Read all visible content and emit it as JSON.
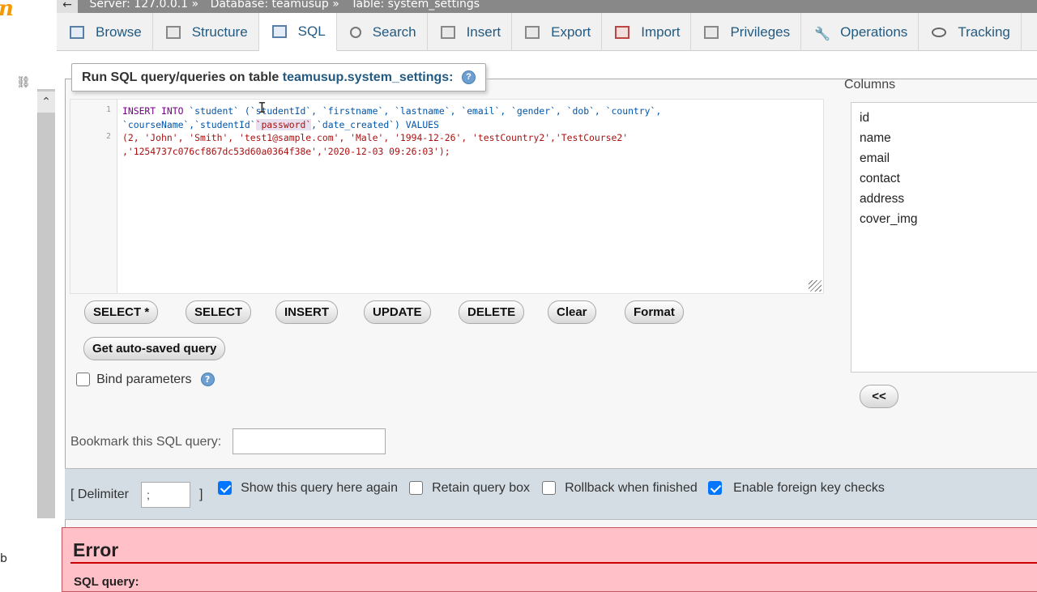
{
  "breadcrumb": {
    "back": "←",
    "server": "Server: 127.0.0.1",
    "sep": "»",
    "database": "Database: teamusup",
    "table": "Table: system_settings"
  },
  "tabs": [
    {
      "label": "Browse",
      "icon": "browse-icon"
    },
    {
      "label": "Structure",
      "icon": "structure-icon"
    },
    {
      "label": "SQL",
      "icon": "sql-icon",
      "active": true
    },
    {
      "label": "Search",
      "icon": "search-icon"
    },
    {
      "label": "Insert",
      "icon": "insert-icon"
    },
    {
      "label": "Export",
      "icon": "export-icon"
    },
    {
      "label": "Import",
      "icon": "import-icon"
    },
    {
      "label": "Privileges",
      "icon": "privileges-icon"
    },
    {
      "label": "Operations",
      "icon": "wrench-icon"
    },
    {
      "label": "Tracking",
      "icon": "eye-icon"
    }
  ],
  "query_panel": {
    "legend_prefix": "Run SQL query/queries on table ",
    "legend_table": "teamusup.system_settings:",
    "help": "?"
  },
  "editor": {
    "line_numbers": [
      "1",
      "2"
    ],
    "sql": {
      "l1_a": "INSERT INTO",
      "l1_b": "`student`",
      "l1_c": " (`studentId`, `firstname`, `lastname`, `email`, `gender`, `dob`, `country`,",
      "l1w_a": "`courseName`,`studentId`",
      "l1w_b": "`password`",
      "l1w_c": ",`date_created`) VALUES",
      "l2_a": "(2, 'John', 'Smith', 'test1@sample.com', 'Male', '1994-12-26', 'testCountry2','TestCourse2'",
      "l2w_a": ",'1254737c076cf867dc53d60a0364f38e','2020-12-03 09:26:03');"
    }
  },
  "buttons": {
    "select_all": "SELECT *",
    "select": "SELECT",
    "insert": "INSERT",
    "update": "UPDATE",
    "delete": "DELETE",
    "clear": "Clear",
    "format": "Format",
    "auto_saved": "Get auto-saved query",
    "insert_col": "<<"
  },
  "bind_parameters": {
    "label": "Bind parameters",
    "checked": false
  },
  "columns": {
    "header": "Columns",
    "items": [
      "id",
      "name",
      "email",
      "contact",
      "address",
      "cover_img"
    ]
  },
  "bookmark": {
    "label": "Bookmark this SQL query:",
    "value": ""
  },
  "options": {
    "delimiter_label": "[ Delimiter",
    "delimiter_value": ";",
    "delimiter_close": "]",
    "show_again": {
      "label": "Show this query here again",
      "checked": true
    },
    "retain": {
      "label": "Retain query box",
      "checked": false
    },
    "rollback": {
      "label": "Rollback when finished",
      "checked": false
    },
    "foreign_keys": {
      "label": "Enable foreign key checks",
      "checked": true
    }
  },
  "error": {
    "title": "Error",
    "subtitle": "SQL query:"
  },
  "leftnav": {
    "logo": "n",
    "tail": "b"
  },
  "colors": {
    "accent": "#235a81",
    "checkbox_on": "#0075ff",
    "error_bg": "#ffc0c8",
    "error_rule": "#cc0000"
  }
}
